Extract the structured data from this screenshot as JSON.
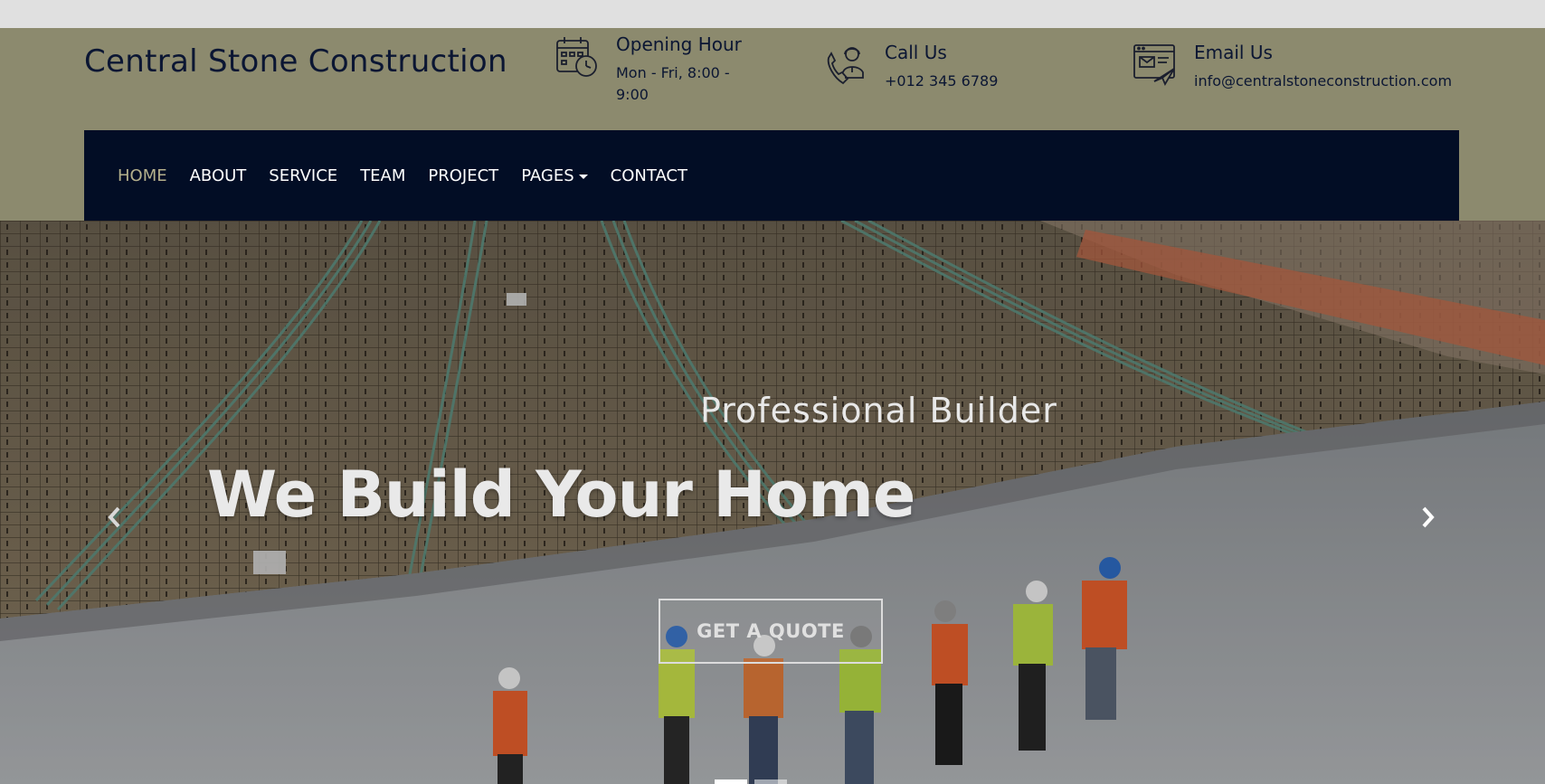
{
  "brand": {
    "name": "Central Stone Construction"
  },
  "contact_info": {
    "hours": {
      "icon": "calendar-clock-icon",
      "title": "Opening Hour",
      "value": "Mon - Fri, 8:00 - 9:00"
    },
    "call": {
      "icon": "phone-support-icon",
      "title": "Call Us",
      "value": "+012 345 6789"
    },
    "email": {
      "icon": "email-send-icon",
      "title": "Email Us",
      "value": "info@centralstoneconstruction.com"
    }
  },
  "nav": {
    "items": [
      {
        "label": "HOME",
        "active": true
      },
      {
        "label": "ABOUT"
      },
      {
        "label": "SERVICE"
      },
      {
        "label": "TEAM"
      },
      {
        "label": "PROJECT"
      },
      {
        "label": "PAGES",
        "dropdown": true
      },
      {
        "label": "CONTACT"
      }
    ]
  },
  "hero": {
    "subtitle": "Professional Builder",
    "title": "We Build Your Home",
    "button_label": "GET A QUOTE",
    "prev_icon": "chevron-left-icon",
    "next_icon": "chevron-right-icon",
    "slide_count": 2,
    "active_slide": 1
  },
  "colors": {
    "header_bg": "#8c8a6e",
    "navbar_bg": "#020d25",
    "brand_text": "#0b1633",
    "nav_active": "#b4b08c",
    "nav_text": "#ffffff"
  }
}
